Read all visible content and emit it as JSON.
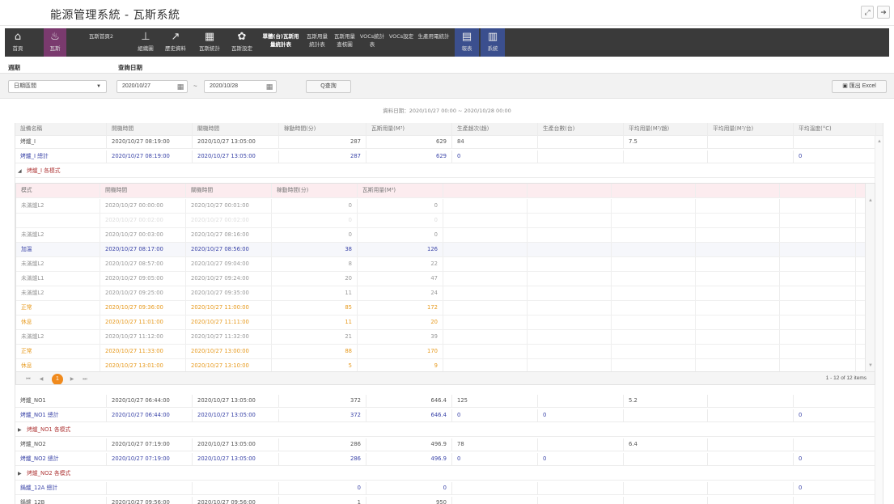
{
  "app": {
    "title": "能源管理系統 - 瓦斯系統"
  },
  "nav": [
    {
      "label": "首頁",
      "icon": "home-icon",
      "glyph": "⌂"
    },
    {
      "label": "瓦斯",
      "icon": "flame-icon",
      "glyph": "♨"
    },
    {
      "label": "瓦斯首頁2",
      "icon": "",
      "glyph": ""
    },
    {
      "label": "組織圖",
      "icon": "org-chart-icon",
      "glyph": "⊥"
    },
    {
      "label": "歷史資料",
      "icon": "line-chart-icon",
      "glyph": "↗"
    },
    {
      "label": "瓦斯統計",
      "icon": "calculator-icon",
      "glyph": "▦"
    },
    {
      "label": "瓦斯設定",
      "icon": "gear-icon",
      "glyph": "✿"
    },
    {
      "label": "單體(台)瓦斯用量統計表",
      "icon": "",
      "glyph": ""
    },
    {
      "label": "瓦斯用量統計表",
      "icon": "",
      "glyph": ""
    },
    {
      "label": "瓦斯用量查核圖",
      "icon": "",
      "glyph": ""
    },
    {
      "label": "VOCs統計表",
      "icon": "",
      "glyph": ""
    },
    {
      "label": "VOCs設定",
      "icon": "",
      "glyph": ""
    },
    {
      "label": "生產用電統計",
      "icon": "",
      "glyph": ""
    },
    {
      "label": "報表",
      "icon": "report-icon",
      "glyph": "▤"
    },
    {
      "label": "系統",
      "icon": "system-icon",
      "glyph": "▥"
    }
  ],
  "filters": {
    "period_label": "週期",
    "query_date_label": "查詢日期",
    "period_value": "日期區間",
    "start_date": "2020/10/27",
    "end_date": "2020/10/28",
    "range_sep": "~",
    "query_button": "Q查詢",
    "export_button": "匯出 Excel"
  },
  "data_range": "資料日期：2020/10/27 00:00 ~ 2020/10/28 00:00",
  "main_table": {
    "headers": [
      "設備名稱",
      "開機時間",
      "關機時間",
      "稼動時間(分)",
      "瓦斯用量(M³)",
      "生產趟次(趟)",
      "生產台數(台)",
      "平均用量(M³/趟)",
      "平均用量(M³/台)",
      "平均溫度(°C)"
    ],
    "rows_top": [
      {
        "type": "data",
        "cells": [
          "烤爐_I",
          "2020/10/27 08:19:00",
          "2020/10/27 13:05:00",
          "287",
          "629",
          "84",
          "",
          "7.5",
          "",
          ""
        ]
      },
      {
        "type": "total",
        "cells": [
          "烤爐_I 總計",
          "2020/10/27 08:19:00",
          "2020/10/27 13:05:00",
          "287",
          "629",
          "0",
          "",
          "",
          "",
          "0"
        ]
      },
      {
        "type": "group",
        "label": "烤爐_I 各模式",
        "expanded": true
      }
    ],
    "rows_bottom": [
      {
        "type": "data",
        "cells": [
          "烤爐_NO1",
          "2020/10/27 06:44:00",
          "2020/10/27 13:05:00",
          "372",
          "646.4",
          "125",
          "",
          "5.2",
          "",
          ""
        ]
      },
      {
        "type": "total",
        "cells": [
          "烤爐_NO1 總計",
          "2020/10/27 06:44:00",
          "2020/10/27 13:05:00",
          "372",
          "646.4",
          "0",
          "0",
          "",
          "",
          "0"
        ]
      },
      {
        "type": "group",
        "label": "烤爐_NO1 各模式",
        "expanded": false
      },
      {
        "type": "data",
        "cells": [
          "烤爐_NO2",
          "2020/10/27 07:19:00",
          "2020/10/27 13:05:00",
          "286",
          "496.9",
          "78",
          "",
          "6.4",
          "",
          ""
        ]
      },
      {
        "type": "total",
        "cells": [
          "烤爐_NO2 總計",
          "2020/10/27 07:19:00",
          "2020/10/27 13:05:00",
          "286",
          "496.9",
          "0",
          "0",
          "",
          "",
          "0"
        ]
      },
      {
        "type": "group",
        "label": "烤爐_NO2 各模式",
        "expanded": false
      },
      {
        "type": "total",
        "cells": [
          "鍋爐_12A 總計",
          "",
          "",
          "0",
          "0",
          "",
          "",
          "",
          "",
          "0"
        ]
      },
      {
        "type": "data",
        "cells": [
          "鍋爐_12B",
          "2020/10/27 09:56:00",
          "2020/10/27 09:56:00",
          "1",
          "950",
          "",
          "",
          "",
          "",
          ""
        ]
      }
    ]
  },
  "mode_table": {
    "headers": [
      "模式",
      "開機時間",
      "關機時間",
      "稼動時間(分)",
      "瓦斯用量(M³)"
    ],
    "rows": [
      {
        "style": "",
        "cells": [
          "未滿爐L2",
          "2020/10/27 00:00:00",
          "2020/10/27 00:01:00",
          "0",
          "0"
        ]
      },
      {
        "style": "faded",
        "cells": [
          "",
          "2020/10/27 00:02:00",
          "2020/10/27 00:02:00",
          "0",
          "0"
        ]
      },
      {
        "style": "",
        "cells": [
          "未滿爐L2",
          "2020/10/27 00:03:00",
          "2020/10/27 08:16:00",
          "0",
          "0"
        ]
      },
      {
        "style": "blue",
        "cells": [
          "加溫",
          "2020/10/27 08:17:00",
          "2020/10/27 08:56:00",
          "38",
          "126"
        ]
      },
      {
        "style": "",
        "cells": [
          "未滿爐L2",
          "2020/10/27 08:57:00",
          "2020/10/27 09:04:00",
          "8",
          "22"
        ]
      },
      {
        "style": "",
        "cells": [
          "未滿爐L1",
          "2020/10/27 09:05:00",
          "2020/10/27 09:24:00",
          "20",
          "47"
        ]
      },
      {
        "style": "",
        "cells": [
          "未滿爐L2",
          "2020/10/27 09:25:00",
          "2020/10/27 09:35:00",
          "11",
          "24"
        ]
      },
      {
        "style": "orange",
        "cells": [
          "正常",
          "2020/10/27 09:36:00",
          "2020/10/27 11:00:00",
          "85",
          "172"
        ]
      },
      {
        "style": "orange",
        "cells": [
          "休息",
          "2020/10/27 11:01:00",
          "2020/10/27 11:11:00",
          "11",
          "20"
        ]
      },
      {
        "style": "",
        "cells": [
          "未滿爐L2",
          "2020/10/27 11:12:00",
          "2020/10/27 11:32:00",
          "21",
          "39"
        ]
      },
      {
        "style": "orange",
        "cells": [
          "正常",
          "2020/10/27 11:33:00",
          "2020/10/27 13:00:00",
          "88",
          "170"
        ]
      },
      {
        "style": "orange",
        "cells": [
          "休息",
          "2020/10/27 13:01:00",
          "2020/10/27 13:10:00",
          "5",
          "9"
        ]
      }
    ],
    "pager": {
      "current_page": "1",
      "info": "1 - 12 of 12 items"
    }
  },
  "colors": {
    "nav_bg": "#3a3a3a",
    "nav_active": "#7a3a6e",
    "total_text": "#3a44a8",
    "mode_header_bg": "#fcecef",
    "highlight_orange": "#e79a1e",
    "page_orange": "#f08a1d"
  }
}
